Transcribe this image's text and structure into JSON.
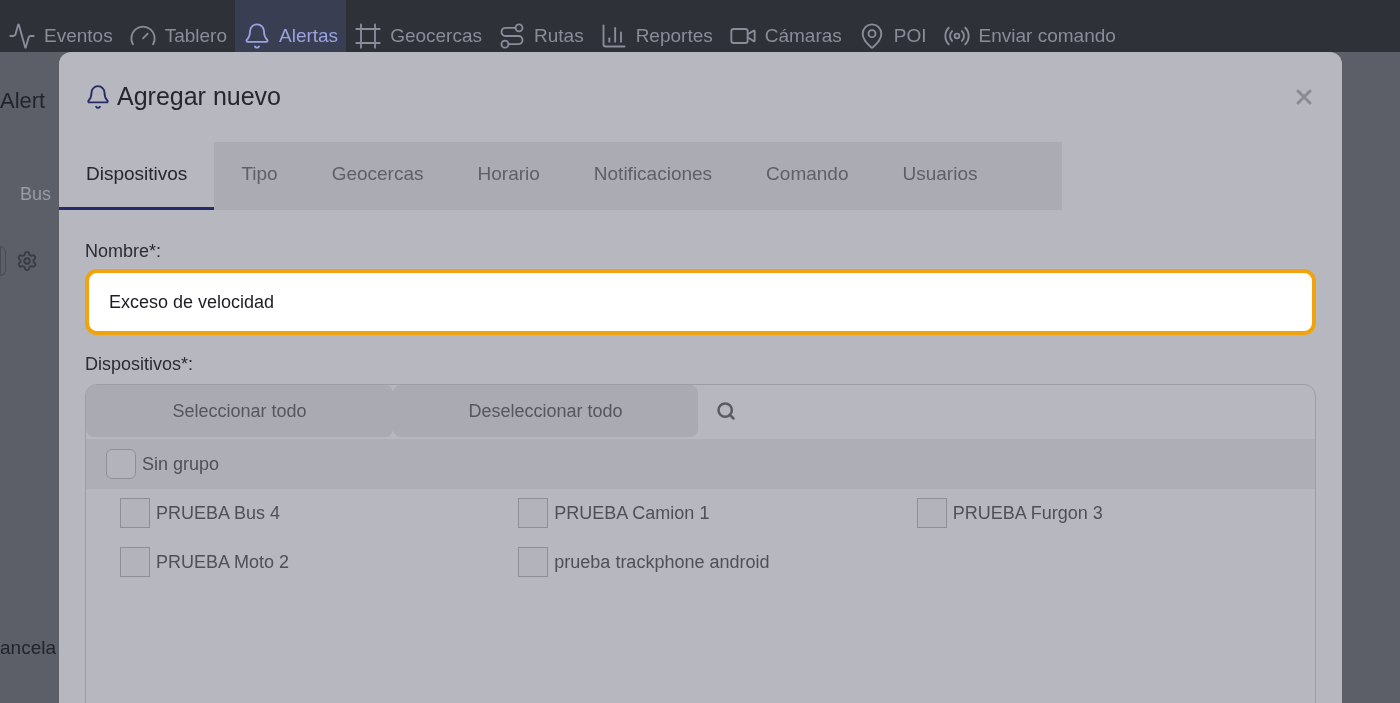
{
  "nav": [
    {
      "label": "Eventos",
      "selected": false
    },
    {
      "label": "Tablero",
      "selected": false
    },
    {
      "label": "Alertas",
      "selected": true
    },
    {
      "label": "Geocercas",
      "selected": false
    },
    {
      "label": "Rutas",
      "selected": false
    },
    {
      "label": "Reportes",
      "selected": false
    },
    {
      "label": "Cámaras",
      "selected": false
    },
    {
      "label": "POI",
      "selected": false
    },
    {
      "label": "Enviar comando",
      "selected": false
    }
  ],
  "page": {
    "title": "Alert",
    "search_placeholder": "Bus",
    "footer_button": "ancela"
  },
  "modal": {
    "title": "Agregar nuevo",
    "tabs": [
      {
        "label": "Dispositivos",
        "selected": true
      },
      {
        "label": "Tipo",
        "selected": false
      },
      {
        "label": "Geocercas",
        "selected": false
      },
      {
        "label": "Horario",
        "selected": false
      },
      {
        "label": "Notificaciones",
        "selected": false
      },
      {
        "label": "Comando",
        "selected": false
      },
      {
        "label": "Usuarios",
        "selected": false
      }
    ],
    "name_label": "Nombre*:",
    "name_value": "Exceso de velocidad",
    "devices_label": "Dispositivos*:",
    "select_all": "Seleccionar todo",
    "deselect_all": "Deseleccionar todo",
    "groups": [
      {
        "label": "Sin grupo",
        "checked": false,
        "devices": [
          {
            "label": "PRUEBA Bus 4",
            "checked": false
          },
          {
            "label": "PRUEBA Camion 1",
            "checked": false
          },
          {
            "label": "PRUEBA Furgon 3",
            "checked": false
          },
          {
            "label": "PRUEBA Moto 2",
            "checked": false
          },
          {
            "label": "prueba trackphone android",
            "checked": false
          }
        ]
      }
    ]
  }
}
